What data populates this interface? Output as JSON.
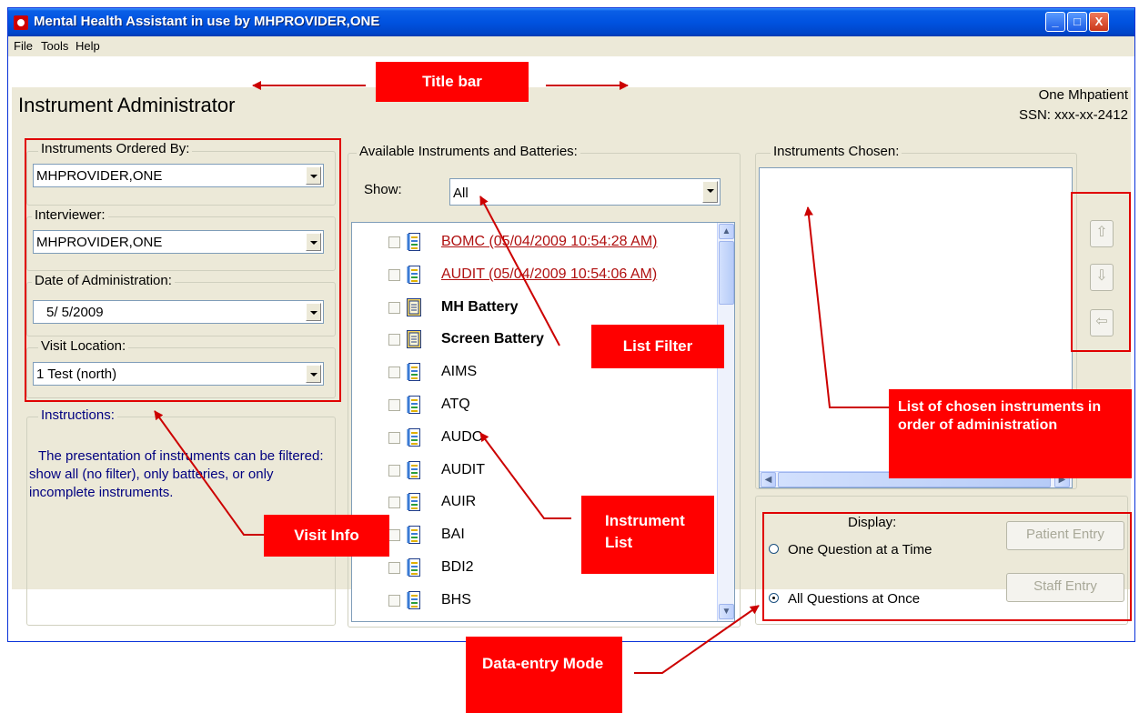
{
  "window": {
    "title": "Mental Health Assistant in use by MHPROVIDER,ONE",
    "minimize": "_",
    "maximize": "□",
    "close": "X"
  },
  "menu": [
    "File",
    "Tools",
    "Help"
  ],
  "page_title": "Instrument Administrator",
  "patient": {
    "name": "One Mhpatient",
    "ssn": "SSN: xxx-xx-2412"
  },
  "visit": {
    "ordered_by_label": "Instruments Ordered By:",
    "ordered_by_value": "MHPROVIDER,ONE",
    "interviewer_label": "Interviewer:",
    "interviewer_value": "MHPROVIDER,ONE",
    "date_label": "Date of Administration:",
    "date_value": "5/ 5/2009",
    "location_label": "Visit Location:",
    "location_value": "1 Test (north)"
  },
  "instructions": {
    "label": "Instructions:",
    "text": "The presentation of instruments can be filtered: show all (no filter), only batteries, or only incomplete instruments."
  },
  "available": {
    "label": "Available Instruments and Batteries:",
    "show_label": "Show:",
    "show_value": "All",
    "items": [
      {
        "label": "BOMC (05/04/2009 10:54:28 AM)",
        "style": "link",
        "icon": "instrument-icon"
      },
      {
        "label": "AUDIT  (05/04/2009 10:54:06 AM)",
        "style": "link",
        "icon": "instrument-icon"
      },
      {
        "label": "MH Battery",
        "style": "bold",
        "icon": "battery-icon"
      },
      {
        "label": "Screen Battery",
        "style": "bold",
        "icon": "battery-icon"
      },
      {
        "label": "AIMS",
        "style": "normal",
        "icon": "instrument-icon"
      },
      {
        "label": "ATQ",
        "style": "normal",
        "icon": "instrument-icon"
      },
      {
        "label": "AUDC",
        "style": "normal",
        "icon": "instrument-icon"
      },
      {
        "label": "AUDIT",
        "style": "normal",
        "icon": "instrument-icon"
      },
      {
        "label": "AUIR",
        "style": "normal",
        "icon": "instrument-icon"
      },
      {
        "label": "BAI",
        "style": "normal",
        "icon": "instrument-icon"
      },
      {
        "label": "BDI2",
        "style": "normal",
        "icon": "instrument-icon"
      },
      {
        "label": "BHS",
        "style": "normal",
        "icon": "instrument-icon"
      }
    ]
  },
  "chosen": {
    "label": "Instruments Chosen:",
    "move_up": "⇧",
    "move_down": "⇩",
    "remove": "⇦"
  },
  "display": {
    "label": "Display:",
    "option_one": "One Question at a Time",
    "option_all": "All Questions at Once",
    "selected": "All Questions at Once",
    "patient_entry": "Patient Entry",
    "staff_entry": "Staff Entry"
  },
  "annotations": {
    "title_bar": "Title bar",
    "list_filter": "List Filter",
    "chosen_list": "List of chosen instruments in order of administration",
    "instrument_list": "Instrument List",
    "visit_info": "Visit Info",
    "data_entry_mode": "Data-entry Mode"
  },
  "colors": {
    "title_bar_blue": "#0052e0",
    "dialog_face": "#ece9d8",
    "annotation_red": "#ff0000",
    "link_red": "#b01010",
    "instructions_text": "#000080"
  }
}
